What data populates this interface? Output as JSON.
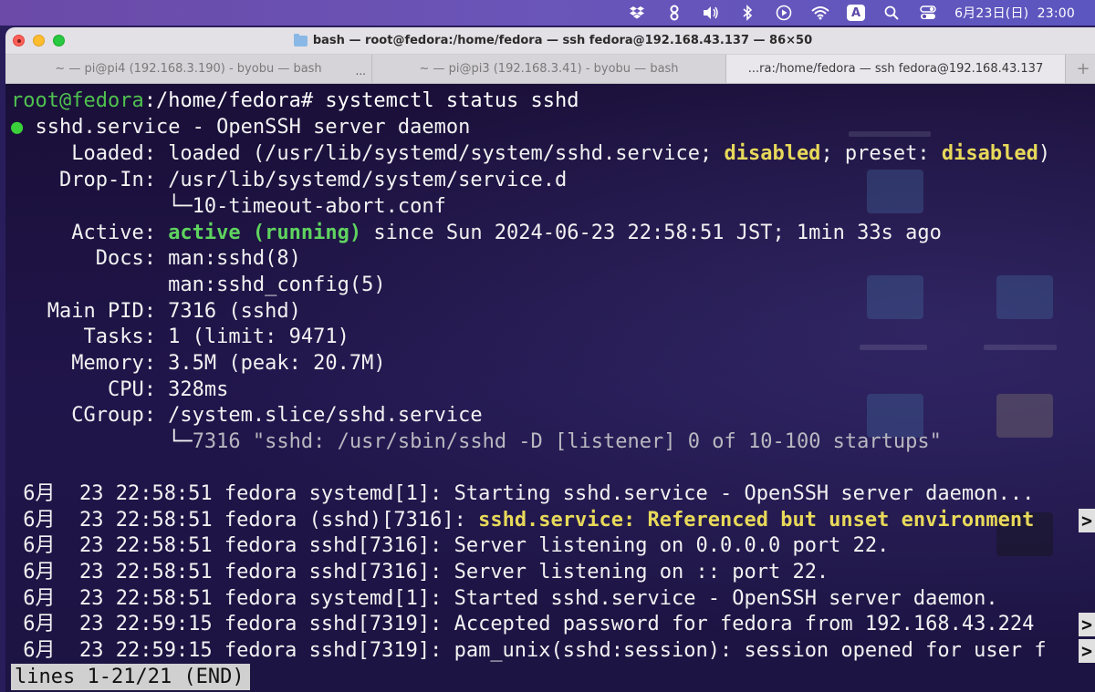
{
  "menubar": {
    "icons": [
      "dropbox-icon",
      "gear-stack-icon",
      "volume-icon",
      "bluetooth-icon",
      "play-icon",
      "wifi-icon",
      "input-source-icon",
      "search-icon",
      "control-center-icon"
    ],
    "input_source": "A",
    "date": "6月23日(日)",
    "time": "23:00"
  },
  "window": {
    "title": "bash — root@fedora:/home/fedora — ssh fedora@192.168.43.137 — 86×50",
    "tabs": [
      {
        "label": "~ — pi@pi4 (192.168.3.190) - byobu — bash",
        "extra": "..."
      },
      {
        "label": "~ — pi@pi3 (192.168.3.41) - byobu — bash"
      },
      {
        "label": "...ra:/home/fedora — ssh fedora@192.168.43.137"
      }
    ],
    "add_tab": "+"
  },
  "terminal": {
    "prompt_user": "root@fedora",
    "prompt_path": ":/home/fedora",
    "prompt_cmd": "# systemctl status sshd",
    "service_dot": "●",
    "service_line": " sshd.service - OpenSSH server daemon",
    "loaded_label": "     Loaded: ",
    "loaded_value": "loaded (/usr/lib/systemd/system/sshd.service; ",
    "loaded_disabled": "disabled",
    "loaded_mid": "; preset: ",
    "loaded_preset": "disabled",
    "loaded_end": ")",
    "dropin_label": "    Drop-In: ",
    "dropin_value": "/usr/lib/systemd/system/service.d",
    "dropin_sub": "             └─10-timeout-abort.conf",
    "active_label": "     Active: ",
    "active_value": "active (running)",
    "active_rest": " since Sun 2024-06-23 22:58:51 JST; 1min 33s ago",
    "docs_line1": "       Docs: man:sshd(8)",
    "docs_line2": "             man:sshd_config(5)",
    "mainpid": "   Main PID: 7316 (sshd)",
    "tasks": "      Tasks: 1 (limit: 9471)",
    "memory": "     Memory: 3.5M (peak: 20.7M)",
    "cpu": "        CPU: 328ms",
    "cgroup": "     CGroup: /system.slice/sshd.service",
    "cgroup_sub_prefix": "             └─",
    "cgroup_sub": "7316 \"sshd: /usr/sbin/sshd -D [listener] 0 of 10-100 startups\"",
    "log1": " 6月  23 22:58:51 fedora systemd[1]: Starting sshd.service - OpenSSH server daemon...",
    "log2_pre": " 6月  23 22:58:51 fedora (sshd)[7316]: ",
    "log2_warn": "sshd.service: Referenced but unset environment",
    "log3": " 6月  23 22:58:51 fedora sshd[7316]: Server listening on 0.0.0.0 port 22.",
    "log4": " 6月  23 22:58:51 fedora sshd[7316]: Server listening on :: port 22.",
    "log5": " 6月  23 22:58:51 fedora systemd[1]: Started sshd.service - OpenSSH server daemon.",
    "log6": " 6月  23 22:59:15 fedora sshd[7319]: Accepted password for fedora from 192.168.43.224",
    "log7": " 6月  23 22:59:15 fedora sshd[7319]: pam_unix(sshd:session): session opened for user f",
    "overflow_marker": ">",
    "pager_status": "lines 1-21/21 (END)"
  }
}
